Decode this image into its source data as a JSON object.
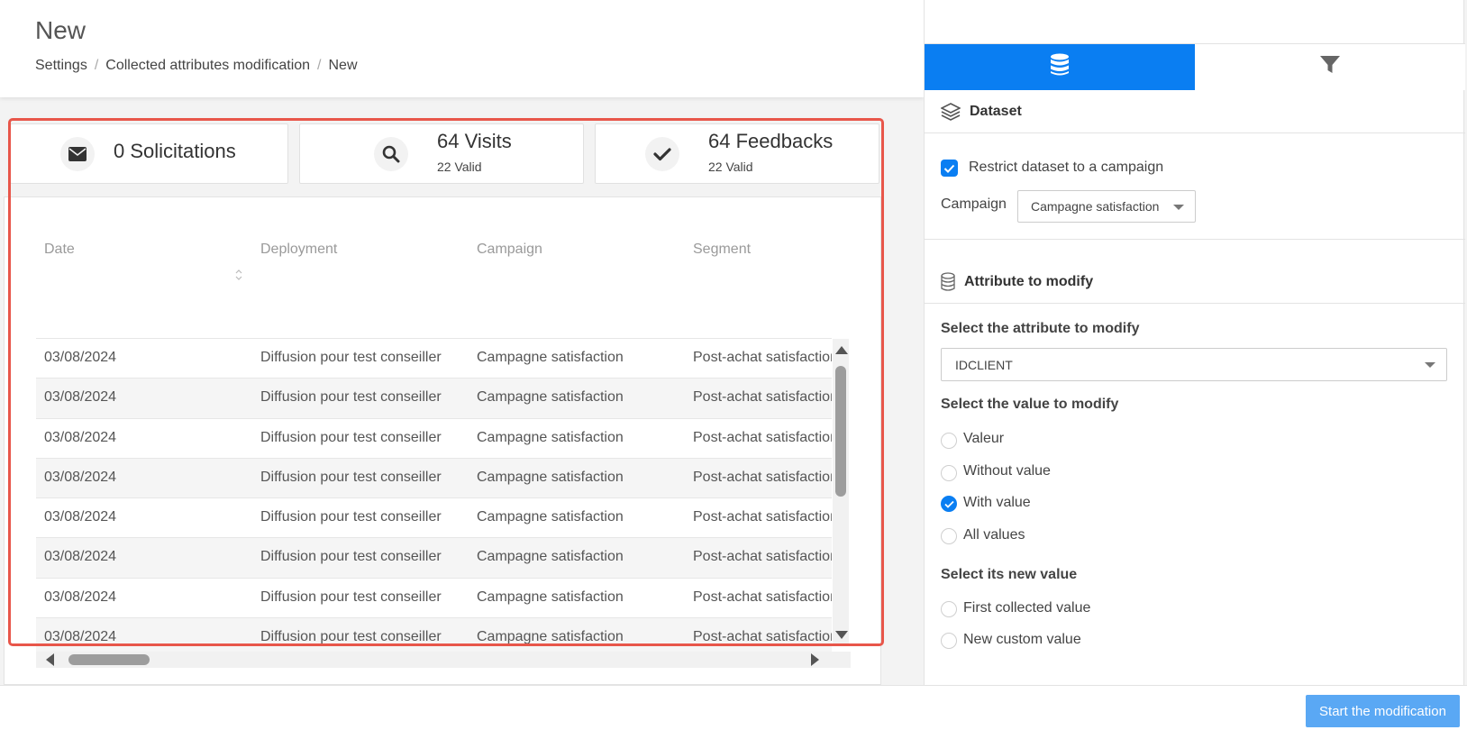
{
  "header": {
    "title": "New",
    "breadcrumb": [
      "Settings",
      "Collected attributes modification",
      "New"
    ],
    "separator": "/"
  },
  "stats": [
    {
      "icon": "envelope-icon",
      "title": "0 Solicitations",
      "subtitle": ""
    },
    {
      "icon": "search-icon",
      "title": "64 Visits",
      "subtitle": "22 Valid"
    },
    {
      "icon": "check-icon",
      "title": "64 Feedbacks",
      "subtitle": "22 Valid"
    }
  ],
  "table": {
    "columns": [
      "Date",
      "Deployment",
      "Campaign",
      "Segment"
    ],
    "rows": [
      [
        "03/08/2024",
        "Diffusion pour test conseiller",
        "Campagne satisfaction",
        "Post-achat satisfaction"
      ],
      [
        "03/08/2024",
        "Diffusion pour test conseiller",
        "Campagne satisfaction",
        "Post-achat satisfaction"
      ],
      [
        "03/08/2024",
        "Diffusion pour test conseiller",
        "Campagne satisfaction",
        "Post-achat satisfaction"
      ],
      [
        "03/08/2024",
        "Diffusion pour test conseiller",
        "Campagne satisfaction",
        "Post-achat satisfaction"
      ],
      [
        "03/08/2024",
        "Diffusion pour test conseiller",
        "Campagne satisfaction",
        "Post-achat satisfaction"
      ],
      [
        "03/08/2024",
        "Diffusion pour test conseiller",
        "Campagne satisfaction",
        "Post-achat satisfaction"
      ],
      [
        "03/08/2024",
        "Diffusion pour test conseiller",
        "Campagne satisfaction",
        "Post-achat satisfaction"
      ],
      [
        "03/08/2024",
        "Diffusion pour test conseiller",
        "Campagne satisfaction",
        "Post-achat satisfaction"
      ]
    ]
  },
  "right_panel": {
    "tabs": [
      {
        "icon": "database-icon",
        "active": true
      },
      {
        "icon": "filter-icon",
        "active": false
      }
    ],
    "dataset": {
      "title": "Dataset",
      "restrict_label": "Restrict dataset to a campaign",
      "restrict_checked": true,
      "campaign_label": "Campaign",
      "campaign_value": "Campagne satisfaction"
    },
    "attribute": {
      "title": "Attribute to modify",
      "select_attribute_label": "Select the attribute to modify",
      "attribute_value": "IDCLIENT",
      "select_value_label": "Select the value to modify",
      "value_options": [
        {
          "label": "Valeur",
          "checked": false
        },
        {
          "label": "Without value",
          "checked": false
        },
        {
          "label": "With value",
          "checked": true
        },
        {
          "label": "All values",
          "checked": false
        }
      ],
      "new_value_label": "Select its new value",
      "new_value_options": [
        {
          "label": "First collected value",
          "checked": false
        },
        {
          "label": "New custom value",
          "checked": false
        }
      ]
    }
  },
  "footer": {
    "start_button": "Start the modification"
  },
  "colors": {
    "accent": "#0a7ef2",
    "button": "#5aa8f4",
    "highlight": "#e8564a"
  }
}
